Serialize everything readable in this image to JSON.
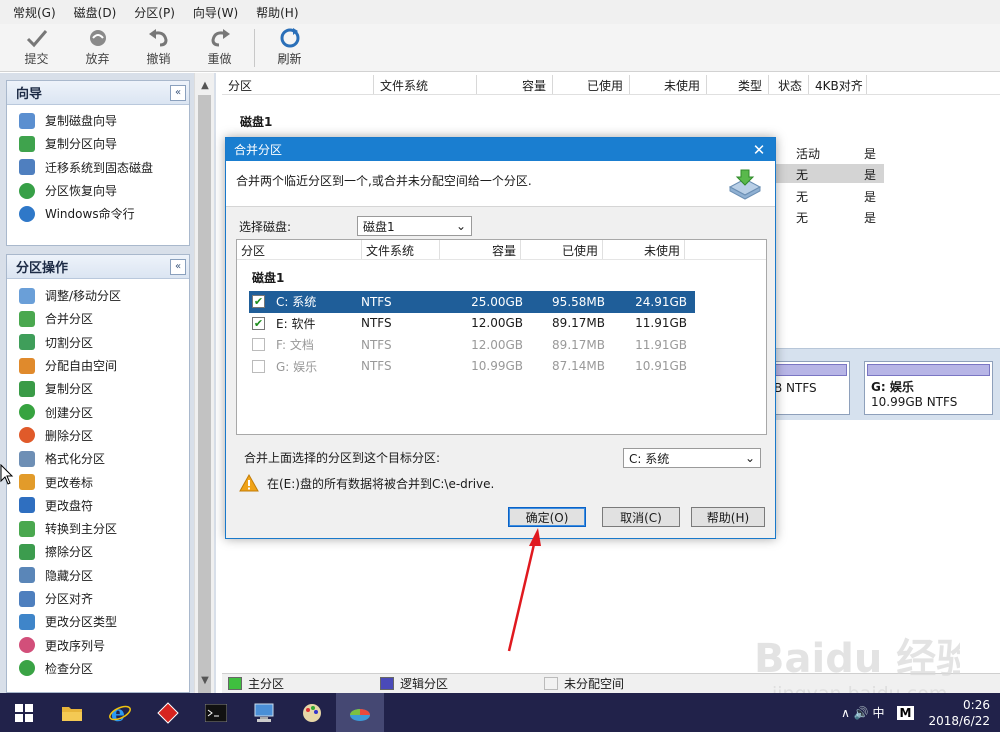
{
  "menubar": [
    "常规(G)",
    "磁盘(D)",
    "分区(P)",
    "向导(W)",
    "帮助(H)"
  ],
  "toolbar": {
    "commit": "提交",
    "discard": "放弃",
    "undo": "撤销",
    "redo": "重做",
    "refresh": "刷新"
  },
  "wizard_panel": {
    "title": "向导",
    "collapse": "«",
    "items": [
      "复制磁盘向导",
      "复制分区向导",
      "迁移系统到固态磁盘",
      "分区恢复向导",
      "Windows命令行"
    ]
  },
  "ops_panel": {
    "title": "分区操作",
    "collapse": "«",
    "items": [
      "调整/移动分区",
      "合并分区",
      "切割分区",
      "分配自由空间",
      "复制分区",
      "创建分区",
      "删除分区",
      "格式化分区",
      "更改卷标",
      "更改盘符",
      "转换到主分区",
      "擦除分区",
      "隐藏分区",
      "分区对齐",
      "更改分区类型",
      "更改序列号",
      "检查分区"
    ]
  },
  "main": {
    "columns": [
      "分区",
      "文件系统",
      "容量",
      "已使用",
      "未使用",
      "类型",
      "状态",
      "4KB对齐"
    ],
    "disk_label": "磁盘1",
    "bg_rows": [
      {
        "status": "活动",
        "align": "是"
      },
      {
        "status": "无",
        "align": "是"
      },
      {
        "status": "无",
        "align": "是"
      },
      {
        "status": "无",
        "align": "是"
      }
    ],
    "diskmap": {
      "partial_block": "B NTFS",
      "g_block_title": "G: 娱乐",
      "g_block_sub": "10.99GB NTFS"
    }
  },
  "legend": {
    "primary": "主分区",
    "logical": "逻辑分区",
    "unallocated": "未分配空间"
  },
  "dialog": {
    "title": "合并分区",
    "close": "✕",
    "description": "合并两个临近分区到一个,或合并未分配空间给一个分区.",
    "select_disk_label": "选择磁盘:",
    "select_disk_value": "磁盘1",
    "table_columns": [
      "分区",
      "文件系统",
      "容量",
      "已使用",
      "未使用"
    ],
    "table_disk": "磁盘1",
    "rows": [
      {
        "name": "C:  系统",
        "fs": "NTFS",
        "capacity": "25.00GB",
        "used": "95.58MB",
        "free": "24.91GB",
        "checked": true,
        "selected": true,
        "enabled": true
      },
      {
        "name": "E:  软件",
        "fs": "NTFS",
        "capacity": "12.00GB",
        "used": "89.17MB",
        "free": "11.91GB",
        "checked": true,
        "selected": false,
        "enabled": true
      },
      {
        "name": "F:  文档",
        "fs": "NTFS",
        "capacity": "12.00GB",
        "used": "89.17MB",
        "free": "11.91GB",
        "checked": false,
        "selected": false,
        "enabled": false
      },
      {
        "name": "G:  娱乐",
        "fs": "NTFS",
        "capacity": "10.99GB",
        "used": "87.14MB",
        "free": "10.91GB",
        "checked": false,
        "selected": false,
        "enabled": false
      }
    ],
    "target_label": "合并上面选择的分区到这个目标分区:",
    "target_value": "C: 系统",
    "warning": "在(E:)盘的所有数据将被合并到C:\\e-drive.",
    "ok": "确定(O)",
    "cancel": "取消(C)",
    "help": "帮助(H)"
  },
  "taskbar": {
    "tray_icons": "∧ 🔊 中",
    "ime": "M",
    "time": "0:26",
    "date": "2018/6/22"
  },
  "watermark": {
    "text": "Baidu 经验",
    "url": "jingyan.baidu.com"
  },
  "colors": {
    "dialog_title": "#1a7ed0",
    "selected_row": "#1f5e99",
    "taskbar": "#21224a",
    "sidebar_bg": "#d8dfe9",
    "annotation_arrow": "#e0191f"
  }
}
